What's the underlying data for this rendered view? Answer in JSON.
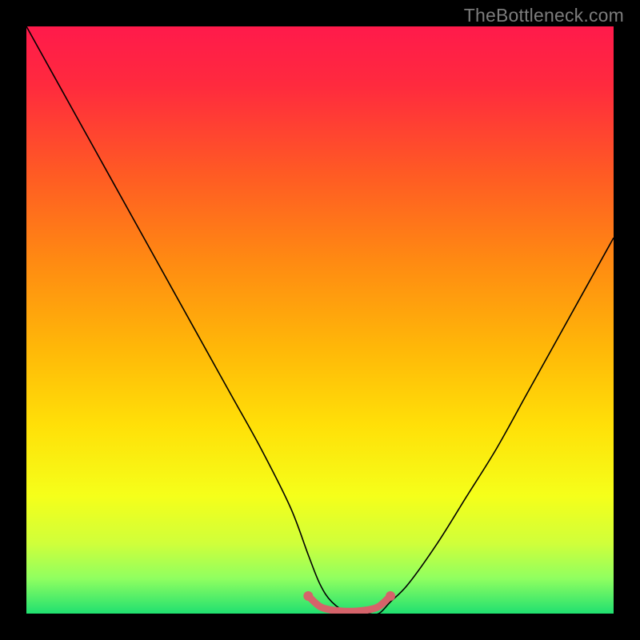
{
  "watermark": "TheBottleneck.com",
  "gradient": {
    "stops": [
      {
        "offset": 0.0,
        "color": "#ff1a4b"
      },
      {
        "offset": 0.1,
        "color": "#ff2a3e"
      },
      {
        "offset": 0.25,
        "color": "#ff5a24"
      },
      {
        "offset": 0.4,
        "color": "#ff8a12"
      },
      {
        "offset": 0.55,
        "color": "#ffb808"
      },
      {
        "offset": 0.68,
        "color": "#ffe008"
      },
      {
        "offset": 0.8,
        "color": "#f5ff1a"
      },
      {
        "offset": 0.88,
        "color": "#d0ff3a"
      },
      {
        "offset": 0.94,
        "color": "#90ff60"
      },
      {
        "offset": 1.0,
        "color": "#20e070"
      }
    ]
  },
  "chart_data": {
    "type": "line",
    "title": "",
    "xlabel": "",
    "ylabel": "",
    "xlim": [
      0,
      100
    ],
    "ylim": [
      0,
      100
    ],
    "series": [
      {
        "name": "bottleneck-curve",
        "stroke": "#000000",
        "x": [
          0,
          5,
          10,
          15,
          20,
          25,
          30,
          35,
          40,
          45,
          48,
          50,
          52,
          55,
          58,
          60,
          62,
          65,
          70,
          75,
          80,
          85,
          90,
          95,
          100
        ],
        "y": [
          100,
          91,
          82,
          73,
          64,
          55,
          46,
          37,
          28,
          18,
          10,
          5,
          2,
          0,
          0,
          0,
          2,
          5,
          12,
          20,
          28,
          37,
          46,
          55,
          64
        ]
      },
      {
        "name": "sweet-spot-band",
        "stroke": "#d5636a",
        "x": [
          48,
          50,
          52,
          54,
          56,
          58,
          60,
          62
        ],
        "y": [
          3.0,
          1.2,
          0.6,
          0.4,
          0.4,
          0.6,
          1.2,
          3.0
        ]
      }
    ]
  }
}
